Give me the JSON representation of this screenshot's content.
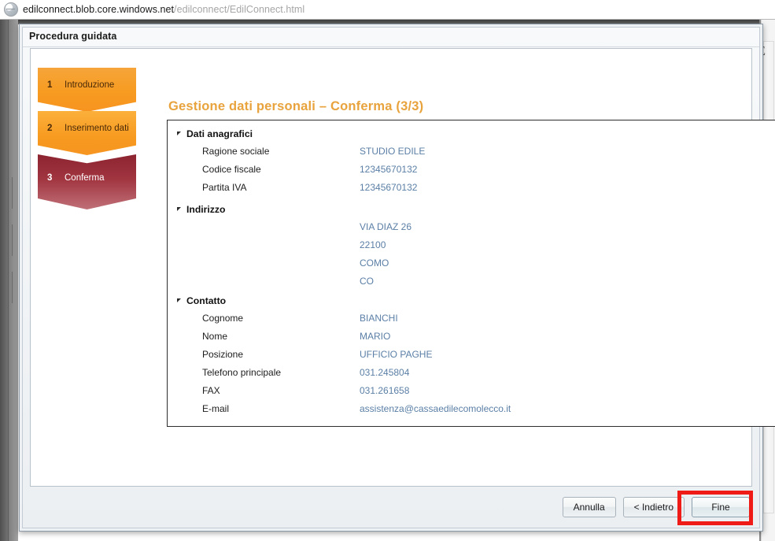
{
  "browser": {
    "url_host": "edilconnect.blob.core.windows.net",
    "url_path": "/edilconnect/EdilConnect.html",
    "site_icon": "globe-icon",
    "ghost_letter": "E"
  },
  "modal": {
    "title": "Procedura guidata"
  },
  "steps": [
    {
      "number": "1",
      "label": "Introduzione",
      "state": "completed",
      "color": "#f79b21"
    },
    {
      "number": "2",
      "label": "Inserimento dati",
      "state": "completed",
      "color": "#f79a20"
    },
    {
      "number": "3",
      "label": "Conferma",
      "state": "current",
      "color": "#9b2d39"
    }
  ],
  "content": {
    "page_title": "Gestione dati personali – Conferma (3/3)",
    "title_color": "#e8a33d",
    "groups": [
      {
        "heading": "Dati anagrafici",
        "expanded": true,
        "rows": [
          {
            "label": "Ragione sociale",
            "value": "STUDIO EDILE"
          },
          {
            "label": "Codice fiscale",
            "value": "12345670132"
          },
          {
            "label": "Partita IVA",
            "value": "12345670132"
          }
        ]
      },
      {
        "heading": "Indirizzo",
        "expanded": true,
        "rows": [
          {
            "label": "",
            "value": "VIA DIAZ 26"
          },
          {
            "label": "",
            "value": "22100"
          },
          {
            "label": "",
            "value": "COMO"
          },
          {
            "label": "",
            "value": "CO"
          }
        ]
      },
      {
        "heading": "Contatto",
        "expanded": true,
        "rows": [
          {
            "label": "Cognome",
            "value": "BIANCHI"
          },
          {
            "label": "Nome",
            "value": "MARIO"
          },
          {
            "label": "Posizione",
            "value": "UFFICIO PAGHE"
          },
          {
            "label": "Telefono principale",
            "value": "031.245804"
          },
          {
            "label": "FAX",
            "value": "031.261658"
          },
          {
            "label": "E-mail",
            "value": "assistenza@cassaedilecomolecco.it"
          }
        ]
      }
    ]
  },
  "footer": {
    "buttons": [
      {
        "label": "Annulla",
        "name": "cancel-button",
        "primary": false
      },
      {
        "label": "< Indietro",
        "name": "back-button",
        "primary": false
      },
      {
        "label": "Fine",
        "name": "finish-button",
        "primary": true
      }
    ],
    "highlight_color": "#ee1b17"
  }
}
